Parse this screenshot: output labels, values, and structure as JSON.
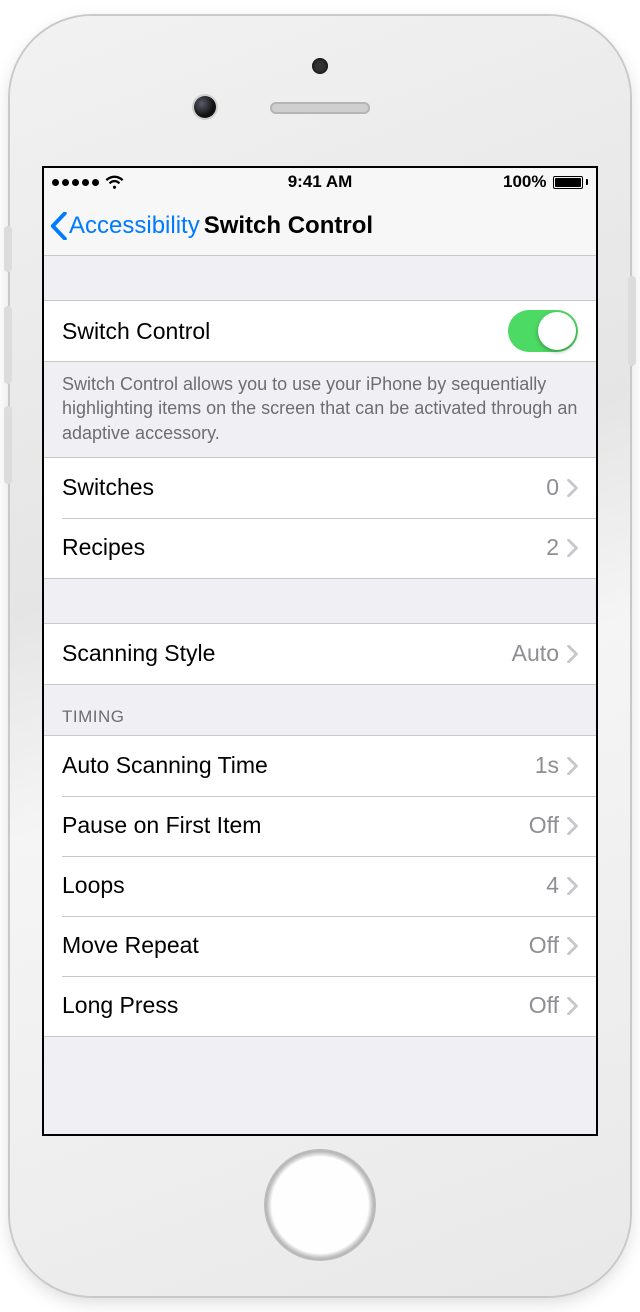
{
  "status_bar": {
    "time": "9:41 AM",
    "battery_percent": "100%"
  },
  "nav": {
    "back_label": "Accessibility",
    "title": "Switch Control"
  },
  "toggle_row": {
    "label": "Switch Control",
    "on": true
  },
  "description": "Switch Control allows you to use your iPhone by sequentially highlighting items on the screen that can be activated through an adaptive accessory.",
  "group2": [
    {
      "label": "Switches",
      "value": "0"
    },
    {
      "label": "Recipes",
      "value": "2"
    }
  ],
  "group3": [
    {
      "label": "Scanning Style",
      "value": "Auto"
    }
  ],
  "timing_header": "TIMING",
  "timing": [
    {
      "label": "Auto Scanning Time",
      "value": "1s"
    },
    {
      "label": "Pause on First Item",
      "value": "Off"
    },
    {
      "label": "Loops",
      "value": "4"
    },
    {
      "label": "Move Repeat",
      "value": "Off"
    },
    {
      "label": "Long Press",
      "value": "Off"
    }
  ],
  "colors": {
    "accent": "#007aff",
    "toggle_on": "#4cd964",
    "secondary_text": "#8e8e93",
    "table_bg": "#efeff4",
    "separator": "#c8c7cc"
  }
}
